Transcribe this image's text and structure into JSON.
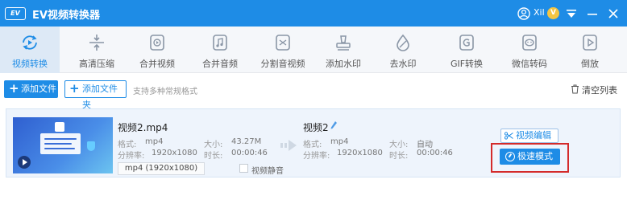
{
  "app": {
    "logo_text": "EV",
    "title": "EV视频转换器",
    "user_name": "Xil",
    "vip_badge": "V",
    "colors": {
      "brand": "#1e8ce6",
      "highlight_outline": "#d42b2b"
    }
  },
  "toolbar": {
    "tools": [
      {
        "label": "视频转换",
        "icon": "convert-icon",
        "active": true
      },
      {
        "label": "高清压缩",
        "icon": "compress-icon",
        "active": false
      },
      {
        "label": "合并视频",
        "icon": "merge-video-icon",
        "active": false
      },
      {
        "label": "合并音频",
        "icon": "merge-audio-icon",
        "active": false
      },
      {
        "label": "分割音视频",
        "icon": "split-icon",
        "active": false
      },
      {
        "label": "添加水印",
        "icon": "stamp-icon",
        "active": false
      },
      {
        "label": "去水印",
        "icon": "drop-icon",
        "active": false
      },
      {
        "label": "GIF转换",
        "icon": "gif-icon",
        "active": false
      },
      {
        "label": "微信转码",
        "icon": "wechat-icon",
        "active": false
      },
      {
        "label": "倒放",
        "icon": "reverse-play-icon",
        "active": false
      }
    ]
  },
  "actions": {
    "add_file": "添加文件",
    "add_folder": "添加文件夹",
    "hint": "支持多种常规格式",
    "clear_list": "清空列表"
  },
  "file": {
    "source": {
      "name": "视频2.mp4",
      "format_label": "格式:",
      "format": "mp4",
      "size_label": "大小:",
      "size": "43.27M",
      "resolution_label": "分辨率:",
      "resolution": "1920x1080",
      "duration_label": "时长:",
      "duration": "00:00:46"
    },
    "output": {
      "name": "视频2",
      "format_label": "格式:",
      "format": "mp4",
      "size_label": "大小:",
      "size": "自动",
      "resolution_label": "分辨率:",
      "resolution": "1920x1080",
      "duration_label": "时长:",
      "duration": "00:00:46"
    },
    "format_select": "mp4 (1920x1080)",
    "mute_label": "视频静音",
    "mute_checked": false,
    "edit_button": "视频编辑",
    "speed_button": "极速模式"
  }
}
